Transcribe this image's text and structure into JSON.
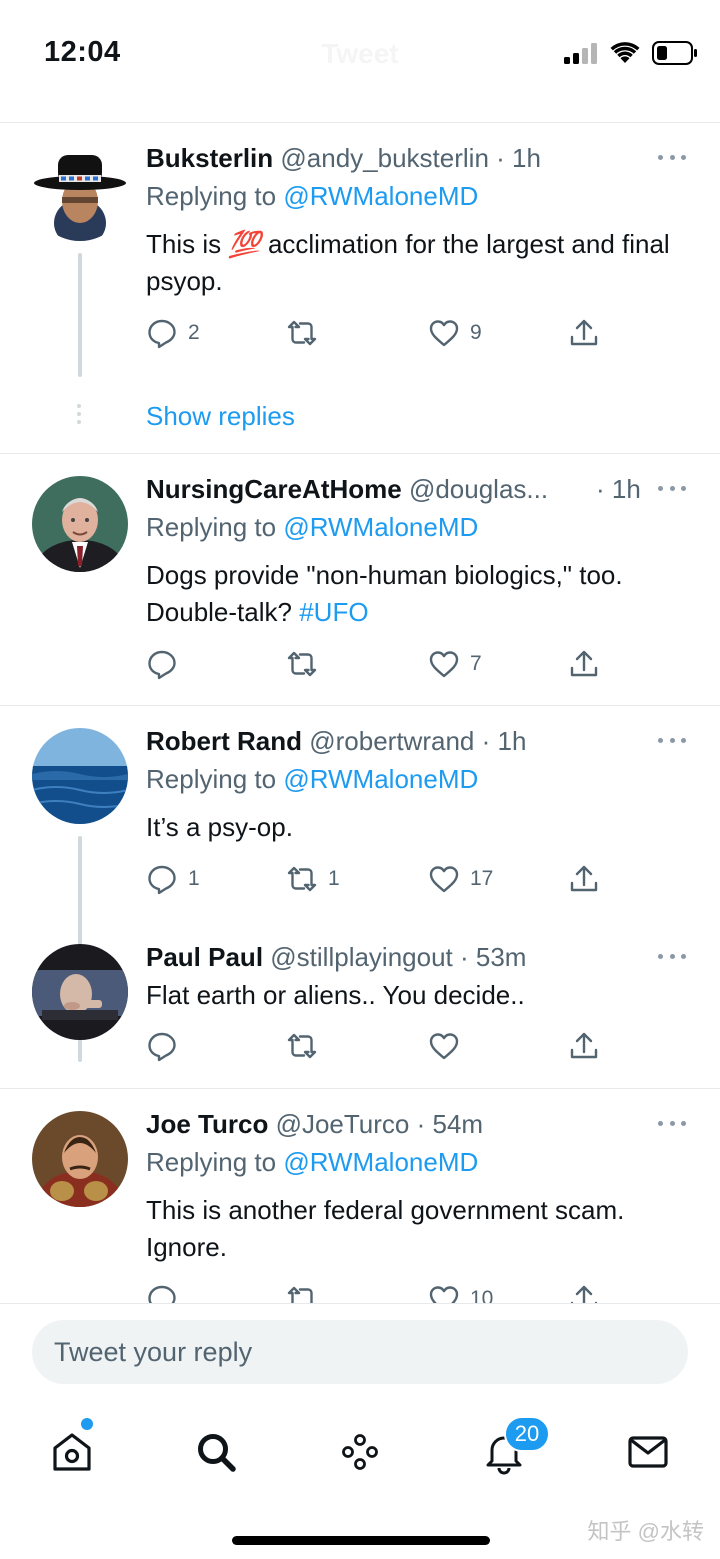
{
  "status_bar": {
    "time": "12:04"
  },
  "header": {
    "title": "Tweet"
  },
  "tweets": [
    {
      "name": "Buksterlin",
      "handle": "@andy_buksterlin",
      "time": "· 1h",
      "replying_label": "Replying to ",
      "replying_to": "@RWMaloneMD",
      "text_before_emoji": "This is ",
      "emoji": "💯",
      "text_after_emoji": " acclimation for the largest and final psyop.",
      "replies": "2",
      "retweets": "",
      "likes": "9"
    },
    {
      "name": "NursingCareAtHome",
      "handle": "@douglas...",
      "time": "· 1h",
      "replying_label": "Replying to ",
      "replying_to": "@RWMaloneMD",
      "text": "Dogs provide \"non-human biologics,\" too. Double-talk? ",
      "hashtag": "#UFO",
      "replies": "",
      "retweets": "",
      "likes": "7"
    },
    {
      "name": "Robert Rand",
      "handle": "@robertwrand",
      "time": "· 1h",
      "replying_label": "Replying to ",
      "replying_to": "@RWMaloneMD",
      "text": "It’s a psy-op.",
      "replies": "1",
      "retweets": "1",
      "likes": "17"
    },
    {
      "name": "Paul Paul",
      "handle": "@stillplayingout",
      "time": "· 53m",
      "text": "Flat earth or aliens.. You decide..",
      "replies": "",
      "retweets": "",
      "likes": ""
    },
    {
      "name": "Joe Turco",
      "handle": "@JoeTurco",
      "time": "· 54m",
      "replying_label": "Replying to ",
      "replying_to": "@RWMaloneMD",
      "text": "This is another federal government scam. Ignore.",
      "replies": "",
      "retweets": "",
      "likes": "10"
    }
  ],
  "show_replies": "Show replies",
  "reply_box": {
    "placeholder": "Tweet your reply"
  },
  "tabbar": {
    "notifications_count": "20"
  },
  "watermark": "知乎 @水转",
  "colors": {
    "accent": "#1d9bf0",
    "secondary_text": "#536471",
    "divider": "#e7e9ea"
  },
  "icons": [
    "reply-icon",
    "retweet-icon",
    "like-icon",
    "share-icon",
    "more-icon",
    "home-icon",
    "search-icon",
    "spaces-icon",
    "notifications-icon",
    "messages-icon"
  ]
}
